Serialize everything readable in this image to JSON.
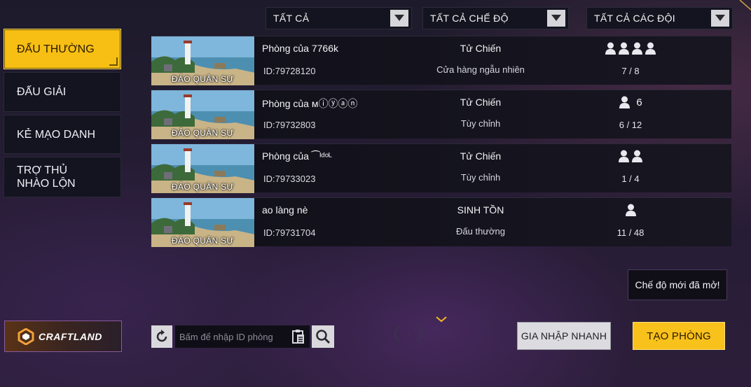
{
  "filters": [
    {
      "label": "TẤT CẢ"
    },
    {
      "label": "TẤT CẢ CHẾ ĐỘ"
    },
    {
      "label": "TẤT CẢ CÁC ĐỘI"
    }
  ],
  "tabs": [
    {
      "label": "ĐẤU THƯỜNG",
      "active": true
    },
    {
      "label": "ĐẤU GIẢI",
      "active": false
    },
    {
      "label": "KẺ MẠO DANH",
      "active": false
    },
    {
      "label": "TRỢ THỦ NHÀO LỘN",
      "active": false
    }
  ],
  "rooms": [
    {
      "map": "ĐẢO QUÂN SỰ",
      "name": "Phòng của 7766k",
      "id": "ID:79728120",
      "mode": "Tử Chiến",
      "sub": "Cửa hàng ngẫu nhiên",
      "player_icons": 4,
      "player_num": "",
      "count": "7 / 8"
    },
    {
      "map": "ĐẢO QUÂN SỰ",
      "name": "Phòng của ᴍⓘⓨⓐⓝ",
      "id": "ID:79732803",
      "mode": "Tử Chiến",
      "sub": "Tùy chỉnh",
      "player_icons": 1,
      "player_num": "6",
      "count": "6 / 12"
    },
    {
      "map": "ĐẢO QUÂN SỰ",
      "name": "Phòng của ⁀ᴵᵈᵒᴸ",
      "id": "ID:79733023",
      "mode": "Tử Chiến",
      "sub": "Tùy chỉnh",
      "player_icons": 2,
      "player_num": "",
      "count": "1 / 4"
    },
    {
      "map": "ĐẢO QUÂN SỰ",
      "name": "ao làng nè",
      "id": "ID:79731704",
      "mode": "SINH TỒN",
      "sub": "Đấu thường",
      "player_icons": 1,
      "player_num": "",
      "count": "11 / 48"
    }
  ],
  "craftland": {
    "label": "CRAFTLAND"
  },
  "search": {
    "placeholder": "Bấm để nhập ID phòng"
  },
  "notice": {
    "label": "Chế độ mới đã mở!"
  },
  "buttons": {
    "quick_join": "GIA NHẬP NHANH",
    "create_room": "TẠO PHÒNG"
  },
  "colors": {
    "accent": "#f7bf14",
    "row_bg": "#13121c",
    "button_light": "#dcdce0"
  }
}
